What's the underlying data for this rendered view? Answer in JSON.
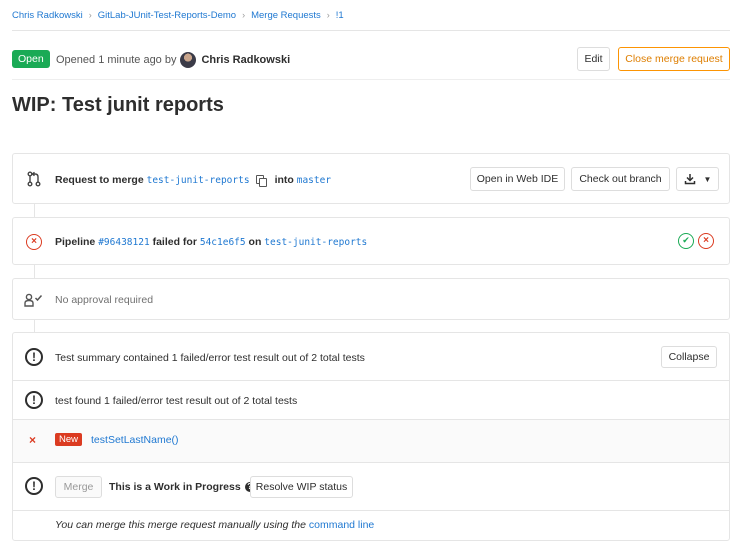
{
  "breadcrumb": {
    "items": [
      "Chris Radkowski",
      "GitLab-JUnit-Test-Reports-Demo",
      "Merge Requests",
      "!1"
    ]
  },
  "header": {
    "status": "Open",
    "opened_prefix": "Opened 1 minute ago by",
    "author": "Chris Radkowski",
    "edit_label": "Edit",
    "close_label": "Close merge request"
  },
  "title": "WIP: Test junit reports",
  "merge_request": {
    "prefix": "Request to merge",
    "source_branch": "test-junit-reports",
    "into_label": "into",
    "target_branch": "master",
    "web_ide_label": "Open in Web IDE",
    "checkout_label": "Check out branch"
  },
  "pipeline": {
    "label": "Pipeline",
    "id": "#96438121",
    "status_text": "failed for",
    "commit": "54c1e6f5",
    "on_label": "on",
    "branch": "test-junit-reports"
  },
  "approval": {
    "text": "No approval required"
  },
  "tests": {
    "summary": "Test summary contained 1 failed/error test result out of 2 total tests",
    "collapse_label": "Collapse",
    "suite_text": "test found 1 failed/error test result out of 2 total tests",
    "new_badge": "New",
    "failed_test": "testSetLastName()"
  },
  "merge": {
    "button_label": "Merge",
    "wip_text": "This is a Work in Progress",
    "resolve_label": "Resolve WIP status",
    "manual_prefix": "You can merge this merge request manually using the",
    "command_line_link": "command line"
  },
  "colors": {
    "success": "#1aaa55",
    "danger": "#db3b21",
    "link": "#1f78d1",
    "warning": "#fc9403"
  },
  "icons": {
    "merge_request": "merge-request-icon",
    "copy": "copy-icon",
    "download": "download-icon",
    "status_failed": "status-failed-icon",
    "status_success": "status-success-icon",
    "approval": "approval-icon",
    "warning": "exclamation-circle-icon",
    "question": "question-circle-icon",
    "close": "close-icon"
  }
}
